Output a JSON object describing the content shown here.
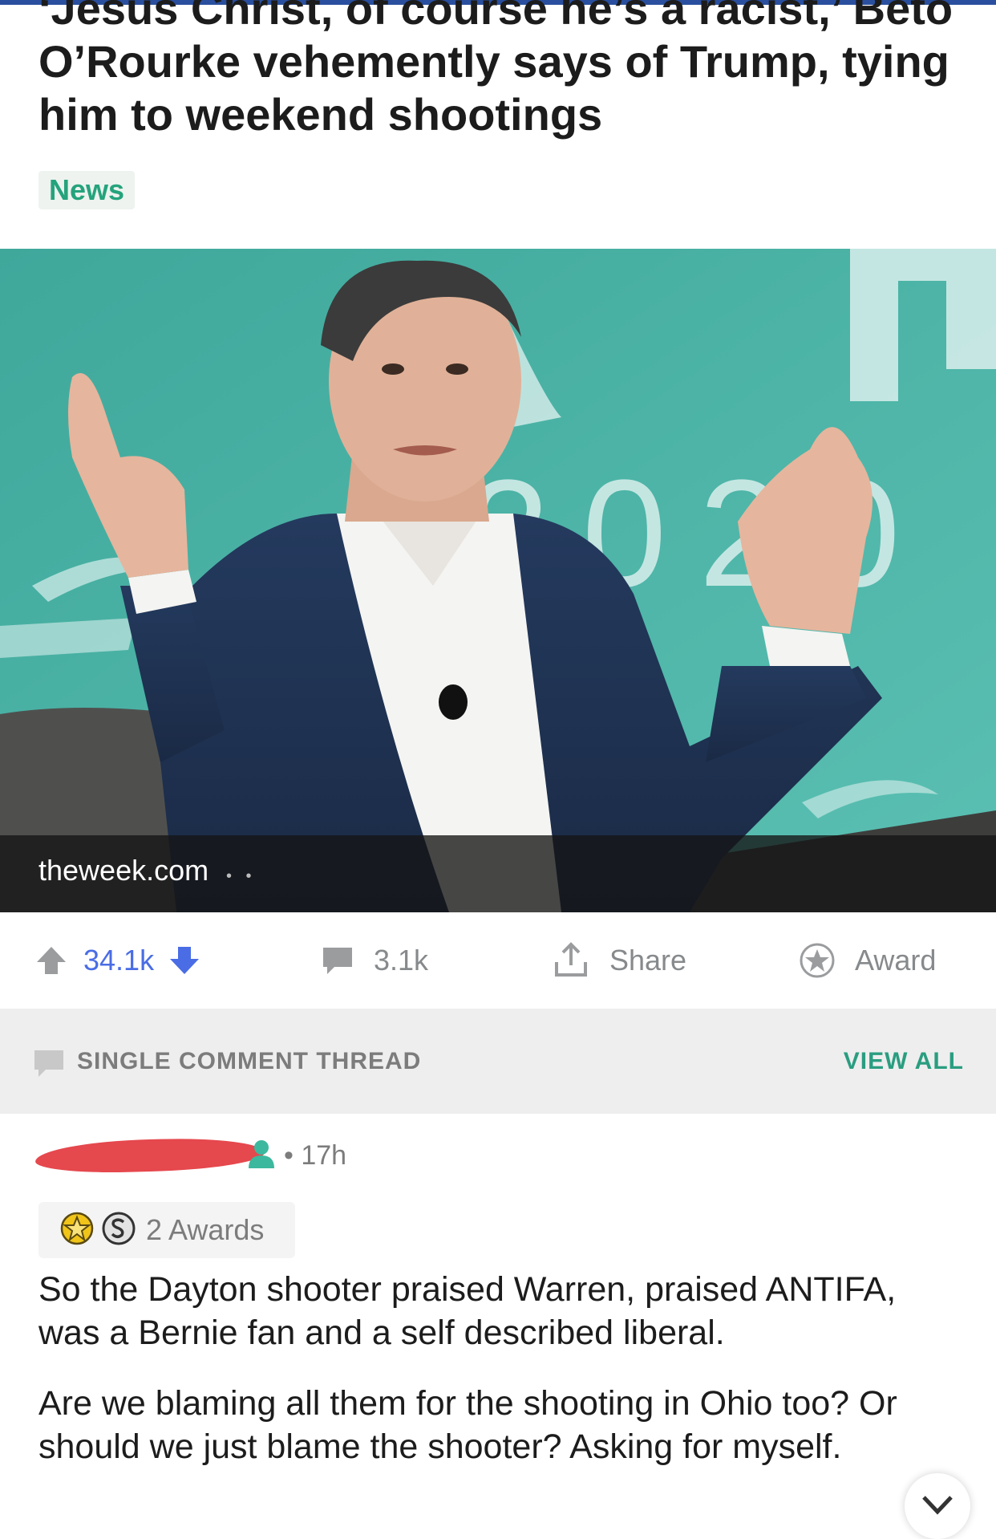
{
  "post": {
    "title": "‘Jesus Christ, of course he’s a racist,’ Beto O’Rourke vehemently says of Trump, tying him to weekend shootings",
    "flair": "News",
    "source_domain": "theweek.com",
    "backdrop_text": "2020"
  },
  "actions": {
    "upvotes": "34.1k",
    "comments": "3.1k",
    "share_label": "Share",
    "award_label": "Award"
  },
  "thread": {
    "label": "SINGLE COMMENT THREAD",
    "view_all": "VIEW ALL"
  },
  "comment": {
    "time": "• 17h",
    "awards": "2 Awards",
    "paragraphs": [
      "So the Dayton shooter praised Warren, praised ANTIFA, was a Bernie fan and a self described liberal.",
      "Are we blaming all them for the shooting in Ohio too? Or should we just blame the shooter? Asking for myself."
    ]
  },
  "colors": {
    "accent": "#4a6de5",
    "flair_green": "#25a37c",
    "view_all_green": "#2a9d80",
    "redaction_red": "#e5484d",
    "hero_teal": "#46aea2"
  },
  "icons": [
    "upvote-icon",
    "downvote-icon",
    "comment-icon",
    "share-icon",
    "award-icon",
    "thread-comment-icon",
    "user-icon",
    "gold-award-icon",
    "silver-award-icon",
    "chevron-down-icon"
  ]
}
